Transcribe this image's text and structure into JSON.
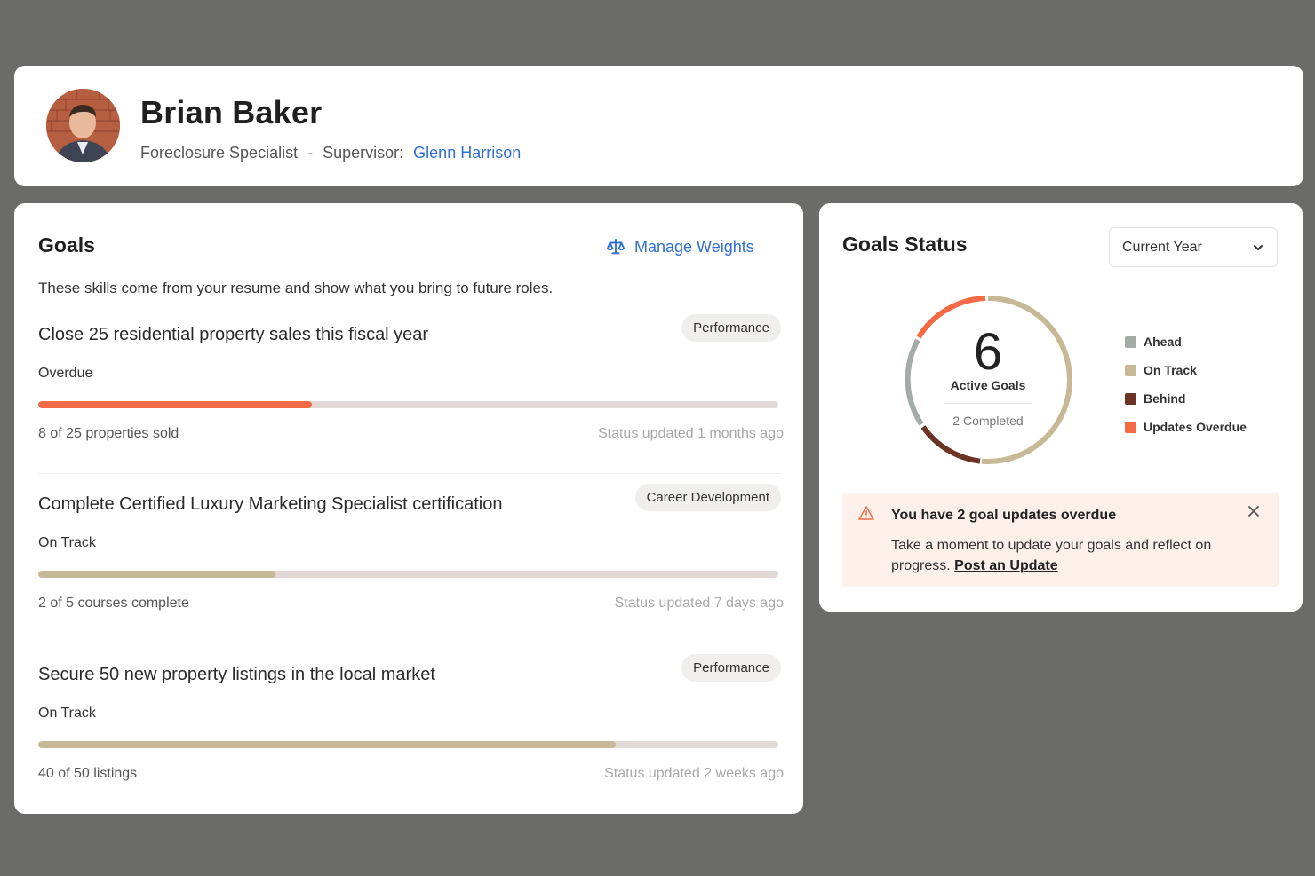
{
  "profile": {
    "name": "Brian Baker",
    "role": "Foreclosure Specialist",
    "separator": "-",
    "supervisor_label": "Supervisor:",
    "supervisor_name": "Glenn Harrison"
  },
  "goals": {
    "title": "Goals",
    "manage_label": "Manage Weights",
    "description": "These skills come from your resume and show what you bring to future roles.",
    "items": [
      {
        "title": "Close 25 residential property sales this fiscal year",
        "tag": "Performance",
        "status": "Overdue",
        "progress_text": "8 of 25 properties sold",
        "updated": "Status updated 1 months ago",
        "progress_fraction": 0.37,
        "color": "#f26b45"
      },
      {
        "title": "Complete Certified Luxury Marketing Specialist certification",
        "tag": "Career Development",
        "status": "On Track",
        "progress_text": "2 of 5 courses complete",
        "updated": "Status updated 7 days ago",
        "progress_fraction": 0.32,
        "color": "#c7b896"
      },
      {
        "title": "Secure 50 new property listings in the local market",
        "tag": "Performance",
        "status": "On Track",
        "progress_text": "40 of 50 listings",
        "updated": "Status updated 2 weeks ago",
        "progress_fraction": 0.78,
        "color": "#c7b896"
      }
    ]
  },
  "status": {
    "title": "Goals Status",
    "period": "Current Year",
    "active_count": "6",
    "active_label": "Active Goals",
    "completed_label": "2 Completed",
    "legend": [
      {
        "label": "Ahead",
        "color": "#a3aca7"
      },
      {
        "label": "On Track",
        "color": "#c7b896"
      },
      {
        "label": "Behind",
        "color": "#6b3424"
      },
      {
        "label": "Updates Overdue",
        "color": "#f26b45"
      }
    ],
    "alert": {
      "title": "You have 2 goal updates overdue",
      "body": "Take a moment to update your goals and reflect on progress.",
      "link": "Post an Update"
    }
  }
}
